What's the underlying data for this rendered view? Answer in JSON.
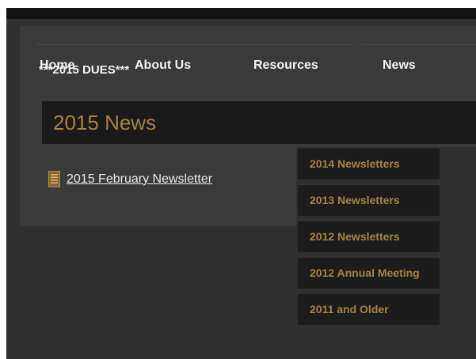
{
  "nav": {
    "items": [
      {
        "label": "Home"
      },
      {
        "label": "About Us"
      },
      {
        "label": "Resources"
      },
      {
        "label": "News"
      }
    ],
    "dues_label": "***2015 DUES***"
  },
  "page": {
    "title": "2015 News"
  },
  "news": {
    "items": [
      {
        "label": "2015 February Newsletter",
        "icon": "document-icon"
      }
    ]
  },
  "sidebar": {
    "items": [
      {
        "label": "2014 Newsletters"
      },
      {
        "label": "2013 Newsletters"
      },
      {
        "label": "2012 Newsletters"
      },
      {
        "label": "2012 Annual Meeting"
      },
      {
        "label": "2011 and Older"
      }
    ]
  },
  "colors": {
    "accent": "#a8823f",
    "background": "#303030",
    "panel": "#3a3a3a",
    "dark": "#1a1a1a",
    "text": "#f3f3f3"
  }
}
